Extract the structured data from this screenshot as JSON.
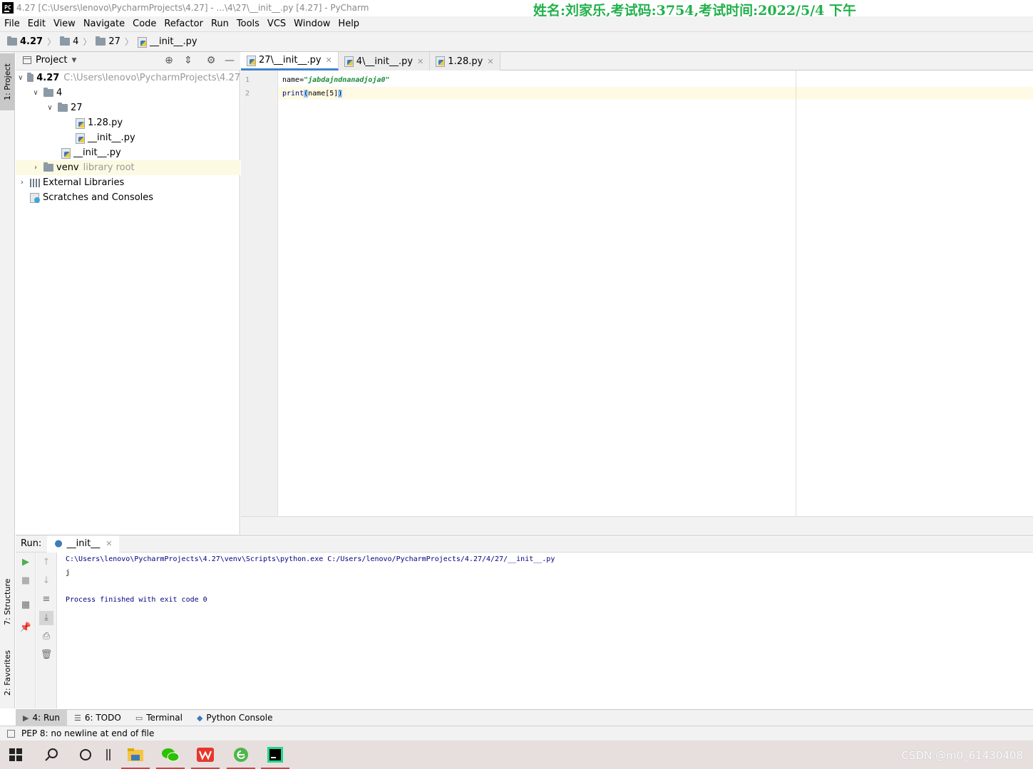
{
  "window": {
    "title": "4.27 [C:\\Users\\lenovo\\PycharmProjects\\4.27] - ...\\4\\27\\__init__.py [4.27] - PyCharm",
    "app_icon": "PC",
    "watermark": "姓名:刘家乐,考试码:3754,考试时间:2022/5/4 下午"
  },
  "menu": [
    "File",
    "Edit",
    "View",
    "Navigate",
    "Code",
    "Refactor",
    "Run",
    "Tools",
    "VCS",
    "Window",
    "Help"
  ],
  "breadcrumb": [
    "4.27",
    "4",
    "27",
    "__init__.py"
  ],
  "side_tabs": {
    "project": "1: Project",
    "structure": "7: Structure",
    "favorites": "2: Favorites"
  },
  "project_panel": {
    "title": "Project",
    "tree": [
      {
        "label": "4.27",
        "hint": "C:\\Users\\lenovo\\PycharmProjects\\4.27",
        "icon": "folder-icon"
      },
      {
        "label": "4",
        "icon": "folder-icon"
      },
      {
        "label": "27",
        "icon": "folder-icon"
      },
      {
        "label": "1.28.py",
        "icon": "python-file-icon"
      },
      {
        "label": "__init__.py",
        "icon": "python-file-icon"
      },
      {
        "label": "__init__.py",
        "icon": "python-file-icon"
      },
      {
        "label": "venv",
        "hint": "library root",
        "icon": "folder-icon"
      },
      {
        "label": "External Libraries",
        "icon": "library-icon"
      },
      {
        "label": "Scratches and Consoles",
        "icon": "scratch-icon"
      }
    ]
  },
  "editor": {
    "tabs": [
      {
        "label": "27\\__init__.py",
        "active": true
      },
      {
        "label": "4\\__init__.py",
        "active": false
      },
      {
        "label": "1.28.py",
        "active": false
      }
    ],
    "line_numbers": [
      "1",
      "2"
    ],
    "code": {
      "line1_var": "name=",
      "line1_str": "\"jabdajndnanadjoja0\"",
      "line2_fn": "print",
      "line2_open": "(",
      "line2_arg": "name[5]",
      "line2_close": ")"
    }
  },
  "run_panel": {
    "label": "Run:",
    "tab": "__init__",
    "console": [
      "C:\\Users\\lenovo\\PycharmProjects\\4.27\\venv\\Scripts\\python.exe C:/Users/lenovo/PycharmProjects/4.27/4/27/__init__.py",
      "j",
      "Process finished with exit code 0"
    ]
  },
  "bottom_tabs": [
    {
      "label": "4: Run",
      "icon": "play-icon",
      "active": true
    },
    {
      "label": "6: TODO",
      "icon": "list-icon",
      "active": false
    },
    {
      "label": "Terminal",
      "icon": "terminal-icon",
      "active": false
    },
    {
      "label": "Python Console",
      "icon": "python-console-icon",
      "active": false
    }
  ],
  "status": {
    "message": "PEP 8: no newline at end of file"
  },
  "taskbar": {
    "items": [
      "windows-start-icon",
      "search-icon",
      "cortana-icon",
      "task-view-icon",
      "file-explorer-icon",
      "wechat-icon",
      "wps-icon",
      "browser-icon",
      "pycharm-icon"
    ],
    "watermark": "CSDN @m0_61430408"
  },
  "colors": {
    "accent": "#4083c9",
    "string": "#1a8c37",
    "watermark": "#22b14c",
    "console_text": "#000080"
  }
}
